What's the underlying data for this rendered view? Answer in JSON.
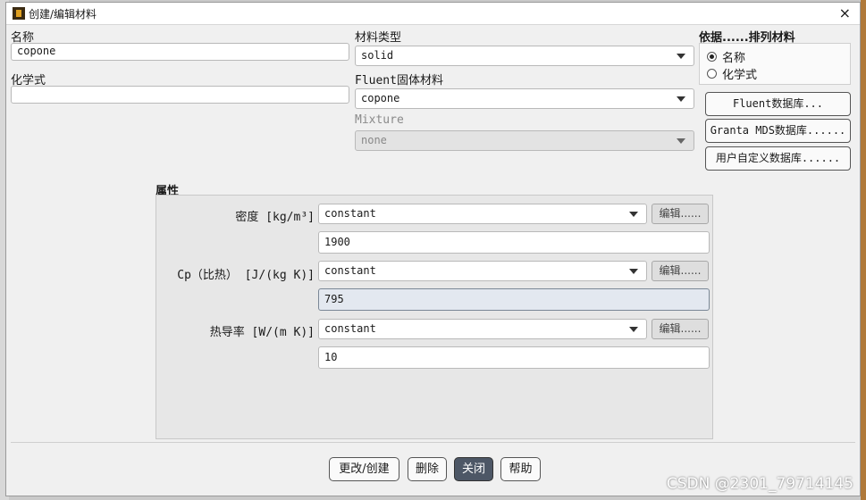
{
  "window": {
    "title": "创建/编辑材料",
    "close_glyph": "×"
  },
  "name": {
    "label": "名称",
    "value": "copone"
  },
  "formula": {
    "label": "化学式",
    "value": ""
  },
  "material_type": {
    "label": "材料类型",
    "value": "solid"
  },
  "fluent_solid": {
    "label": "Fluent固体材料",
    "value": "copone"
  },
  "mixture": {
    "label": "Mixture",
    "value": "none"
  },
  "sort": {
    "label": "依据......排列材料",
    "options": [
      {
        "label": "名称",
        "checked": true
      },
      {
        "label": "化学式",
        "checked": false
      }
    ]
  },
  "db_buttons": {
    "fluent": "Fluent数据库...",
    "granta": "Granta MDS数据库......",
    "user": "用户自定义数据库......"
  },
  "properties": {
    "heading": "属性",
    "edit_label": "编辑......",
    "items": [
      {
        "label": "密度 [kg/m³]",
        "method": "constant",
        "value": "1900"
      },
      {
        "label": "Cp（比热） [J/(kg K)]",
        "method": "constant",
        "value": "795"
      },
      {
        "label": "热导率 [W/(m K)]",
        "method": "constant",
        "value": "10"
      }
    ]
  },
  "footer": {
    "change_create": "更改/创建",
    "delete": "删除",
    "close": "关闭",
    "help": "帮助"
  },
  "watermark": "CSDN @2301_79714145",
  "colors": {
    "primary_button": "#4d5766",
    "dialog_bg": "#f0f0f0",
    "props_bg": "#e7e7e7"
  }
}
